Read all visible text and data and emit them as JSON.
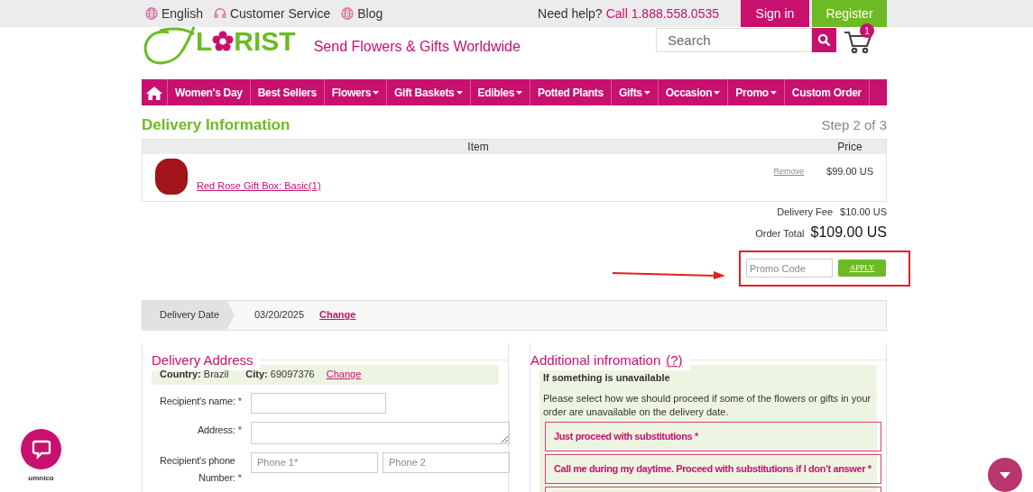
{
  "top_bar": {
    "links": [
      {
        "kind": "globe",
        "label": "English"
      },
      {
        "kind": "headset",
        "label": "Customer Service"
      },
      {
        "kind": "globe",
        "label": "Blog"
      }
    ],
    "help_text": "Need help?",
    "phone": "Call 1.888.558.0535",
    "sign_in": "Sign in",
    "register": "Register"
  },
  "header": {
    "logo_start": "L",
    "logo_end": "RIST",
    "tagline": "Send Flowers & Gifts Worldwide",
    "search_placeholder": "Search",
    "cart_count": "1"
  },
  "nav": [
    {
      "label": "Women's Day",
      "dropdown": false
    },
    {
      "label": "Best Sellers",
      "dropdown": false
    },
    {
      "label": "Flowers",
      "dropdown": true
    },
    {
      "label": "Gift Baskets",
      "dropdown": true
    },
    {
      "label": "Edibles",
      "dropdown": true
    },
    {
      "label": "Potted Plants",
      "dropdown": false
    },
    {
      "label": "Gifts",
      "dropdown": true
    },
    {
      "label": "Occasion",
      "dropdown": true
    },
    {
      "label": "Promo",
      "dropdown": true
    },
    {
      "label": "Custom Order",
      "dropdown": false
    }
  ],
  "page_title": "Delivery Information",
  "step": "Step 2 of 3",
  "cart": {
    "columns": [
      "Item",
      "Price"
    ],
    "rows": [
      {
        "name": "Red Rose Gift Box: Basic(1)",
        "remove": "Remove",
        "price": "$99.00 US"
      }
    ]
  },
  "totals": {
    "fee_label": "Delivery Fee",
    "fee_value": "$10.00 US",
    "total_label": "Order Total",
    "total_value": "$109.00 US"
  },
  "promo": {
    "placeholder": "Promo Code",
    "apply": "APPLY"
  },
  "delivery_date": {
    "label": "Delivery Date",
    "value": "03/20/2025",
    "change": "Change"
  },
  "delivery_address": {
    "title": "Delivery Address",
    "country_label": "Country:",
    "country": "Brazil",
    "city_label": "City:",
    "city": "69097376",
    "change": "Change",
    "fields": [
      {
        "kind": "text",
        "label": "Recipient's name:",
        "required_mark": "*"
      },
      {
        "kind": "textarea",
        "label": "Address:",
        "required_mark": "*"
      },
      {
        "kind": "phone",
        "label": "Recipient's phone Number:",
        "required_mark": "*",
        "placeholders": [
          "Phone 1*",
          "Phone 2"
        ]
      }
    ]
  },
  "additional": {
    "title": "Additional infromation",
    "help": "(?)",
    "heading": "If something is unavailable",
    "description": "Please select how we should proceed if some of the flowers or gifts in your order are unavailable on the delivery date.",
    "options": [
      {
        "kind": "labeled",
        "label": "Just proceed with substitutions *"
      },
      {
        "kind": "labeled",
        "label": "Call me during my daytime. Proceed with substitutions if I don’t answer *"
      },
      {
        "kind": "cut_off"
      }
    ]
  },
  "chat_widget": {
    "label": "umnico"
  }
}
